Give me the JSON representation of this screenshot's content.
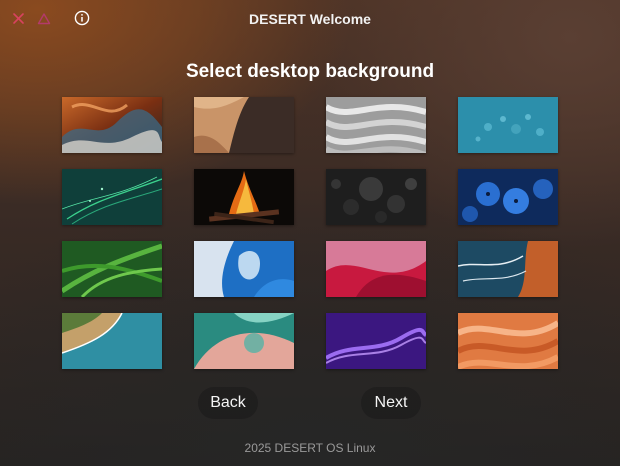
{
  "window": {
    "title": "DESERT Welcome",
    "controls": [
      {
        "icon": "close-icon",
        "color": "#d8435f"
      },
      {
        "icon": "triangle-icon",
        "color": "#b33a6a"
      },
      {
        "icon": "info-icon",
        "color": "#ffffff"
      }
    ]
  },
  "main": {
    "heading": "Select desktop background",
    "wallpapers": [
      {
        "name": "orange-marble"
      },
      {
        "name": "sand-dunes"
      },
      {
        "name": "white-waves"
      },
      {
        "name": "teal-bubbles"
      },
      {
        "name": "green-light-streaks"
      },
      {
        "name": "campfire"
      },
      {
        "name": "dark-spheres"
      },
      {
        "name": "blue-flowers"
      },
      {
        "name": "fern-leaves"
      },
      {
        "name": "blue-glass-abstract"
      },
      {
        "name": "pink-silk"
      },
      {
        "name": "ocean-coast-aerial"
      },
      {
        "name": "beach-aerial"
      },
      {
        "name": "teal-3d-shapes"
      },
      {
        "name": "purple-particles"
      },
      {
        "name": "orange-ribbons"
      }
    ],
    "back_label": "Back",
    "next_label": "Next"
  },
  "footer": {
    "text": "2025 DESERT OS Linux"
  }
}
